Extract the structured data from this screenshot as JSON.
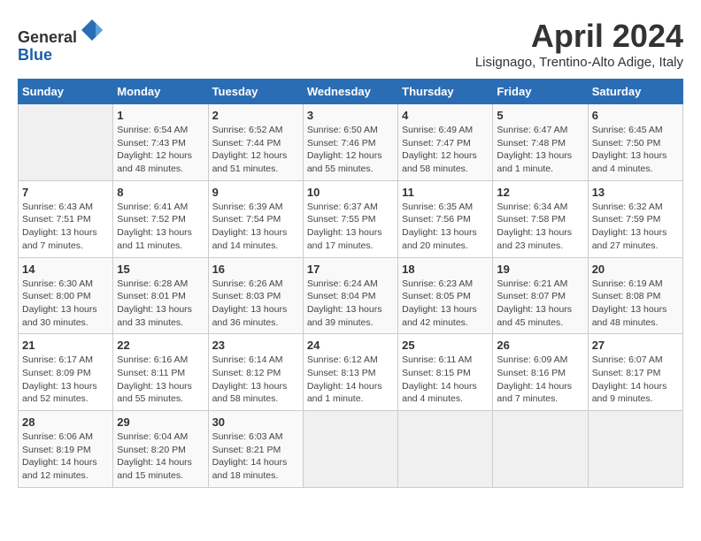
{
  "header": {
    "logo_line1": "General",
    "logo_line2": "Blue",
    "month": "April 2024",
    "location": "Lisignago, Trentino-Alto Adige, Italy"
  },
  "days_of_week": [
    "Sunday",
    "Monday",
    "Tuesday",
    "Wednesday",
    "Thursday",
    "Friday",
    "Saturday"
  ],
  "weeks": [
    [
      {
        "day": "",
        "info": ""
      },
      {
        "day": "1",
        "info": "Sunrise: 6:54 AM\nSunset: 7:43 PM\nDaylight: 12 hours\nand 48 minutes."
      },
      {
        "day": "2",
        "info": "Sunrise: 6:52 AM\nSunset: 7:44 PM\nDaylight: 12 hours\nand 51 minutes."
      },
      {
        "day": "3",
        "info": "Sunrise: 6:50 AM\nSunset: 7:46 PM\nDaylight: 12 hours\nand 55 minutes."
      },
      {
        "day": "4",
        "info": "Sunrise: 6:49 AM\nSunset: 7:47 PM\nDaylight: 12 hours\nand 58 minutes."
      },
      {
        "day": "5",
        "info": "Sunrise: 6:47 AM\nSunset: 7:48 PM\nDaylight: 13 hours\nand 1 minute."
      },
      {
        "day": "6",
        "info": "Sunrise: 6:45 AM\nSunset: 7:50 PM\nDaylight: 13 hours\nand 4 minutes."
      }
    ],
    [
      {
        "day": "7",
        "info": "Sunrise: 6:43 AM\nSunset: 7:51 PM\nDaylight: 13 hours\nand 7 minutes."
      },
      {
        "day": "8",
        "info": "Sunrise: 6:41 AM\nSunset: 7:52 PM\nDaylight: 13 hours\nand 11 minutes."
      },
      {
        "day": "9",
        "info": "Sunrise: 6:39 AM\nSunset: 7:54 PM\nDaylight: 13 hours\nand 14 minutes."
      },
      {
        "day": "10",
        "info": "Sunrise: 6:37 AM\nSunset: 7:55 PM\nDaylight: 13 hours\nand 17 minutes."
      },
      {
        "day": "11",
        "info": "Sunrise: 6:35 AM\nSunset: 7:56 PM\nDaylight: 13 hours\nand 20 minutes."
      },
      {
        "day": "12",
        "info": "Sunrise: 6:34 AM\nSunset: 7:58 PM\nDaylight: 13 hours\nand 23 minutes."
      },
      {
        "day": "13",
        "info": "Sunrise: 6:32 AM\nSunset: 7:59 PM\nDaylight: 13 hours\nand 27 minutes."
      }
    ],
    [
      {
        "day": "14",
        "info": "Sunrise: 6:30 AM\nSunset: 8:00 PM\nDaylight: 13 hours\nand 30 minutes."
      },
      {
        "day": "15",
        "info": "Sunrise: 6:28 AM\nSunset: 8:01 PM\nDaylight: 13 hours\nand 33 minutes."
      },
      {
        "day": "16",
        "info": "Sunrise: 6:26 AM\nSunset: 8:03 PM\nDaylight: 13 hours\nand 36 minutes."
      },
      {
        "day": "17",
        "info": "Sunrise: 6:24 AM\nSunset: 8:04 PM\nDaylight: 13 hours\nand 39 minutes."
      },
      {
        "day": "18",
        "info": "Sunrise: 6:23 AM\nSunset: 8:05 PM\nDaylight: 13 hours\nand 42 minutes."
      },
      {
        "day": "19",
        "info": "Sunrise: 6:21 AM\nSunset: 8:07 PM\nDaylight: 13 hours\nand 45 minutes."
      },
      {
        "day": "20",
        "info": "Sunrise: 6:19 AM\nSunset: 8:08 PM\nDaylight: 13 hours\nand 48 minutes."
      }
    ],
    [
      {
        "day": "21",
        "info": "Sunrise: 6:17 AM\nSunset: 8:09 PM\nDaylight: 13 hours\nand 52 minutes."
      },
      {
        "day": "22",
        "info": "Sunrise: 6:16 AM\nSunset: 8:11 PM\nDaylight: 13 hours\nand 55 minutes."
      },
      {
        "day": "23",
        "info": "Sunrise: 6:14 AM\nSunset: 8:12 PM\nDaylight: 13 hours\nand 58 minutes."
      },
      {
        "day": "24",
        "info": "Sunrise: 6:12 AM\nSunset: 8:13 PM\nDaylight: 14 hours\nand 1 minute."
      },
      {
        "day": "25",
        "info": "Sunrise: 6:11 AM\nSunset: 8:15 PM\nDaylight: 14 hours\nand 4 minutes."
      },
      {
        "day": "26",
        "info": "Sunrise: 6:09 AM\nSunset: 8:16 PM\nDaylight: 14 hours\nand 7 minutes."
      },
      {
        "day": "27",
        "info": "Sunrise: 6:07 AM\nSunset: 8:17 PM\nDaylight: 14 hours\nand 9 minutes."
      }
    ],
    [
      {
        "day": "28",
        "info": "Sunrise: 6:06 AM\nSunset: 8:19 PM\nDaylight: 14 hours\nand 12 minutes."
      },
      {
        "day": "29",
        "info": "Sunrise: 6:04 AM\nSunset: 8:20 PM\nDaylight: 14 hours\nand 15 minutes."
      },
      {
        "day": "30",
        "info": "Sunrise: 6:03 AM\nSunset: 8:21 PM\nDaylight: 14 hours\nand 18 minutes."
      },
      {
        "day": "",
        "info": ""
      },
      {
        "day": "",
        "info": ""
      },
      {
        "day": "",
        "info": ""
      },
      {
        "day": "",
        "info": ""
      }
    ]
  ]
}
